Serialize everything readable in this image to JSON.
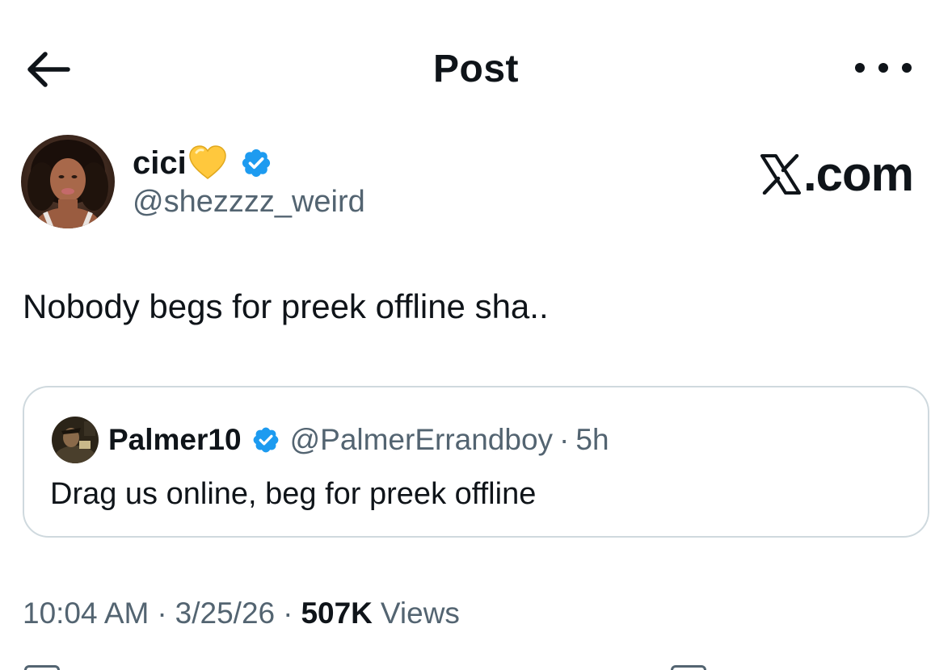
{
  "header": {
    "title": "Post",
    "back_icon": "arrow-left-icon",
    "more_icon": "more-dots-icon"
  },
  "author": {
    "name": "cici",
    "emoji_icon": "yellow-heart-icon",
    "verified_icon": "verified-badge-icon",
    "handle": "@shezzzz_weird"
  },
  "watermark": {
    "logo_icon": "x-logo-icon",
    "suffix": ".com"
  },
  "post": {
    "text": "Nobody begs for preek offline sha.."
  },
  "quote": {
    "name": "Palmer10",
    "verified_icon": "verified-badge-icon",
    "handle": "@PalmerErrandboy",
    "separator": "·",
    "time": "5h",
    "text": "Drag us online, beg for preek offline"
  },
  "meta": {
    "time": "10:04 AM",
    "separator": "·",
    "date": "3/25/26",
    "views_count": "507K",
    "views_label": "Views"
  },
  "colors": {
    "text_primary": "#0f1419",
    "text_secondary": "#536471",
    "verified_blue": "#1d9bf0",
    "border": "#cfd9de",
    "heart_yellow": "#ffc83d"
  }
}
